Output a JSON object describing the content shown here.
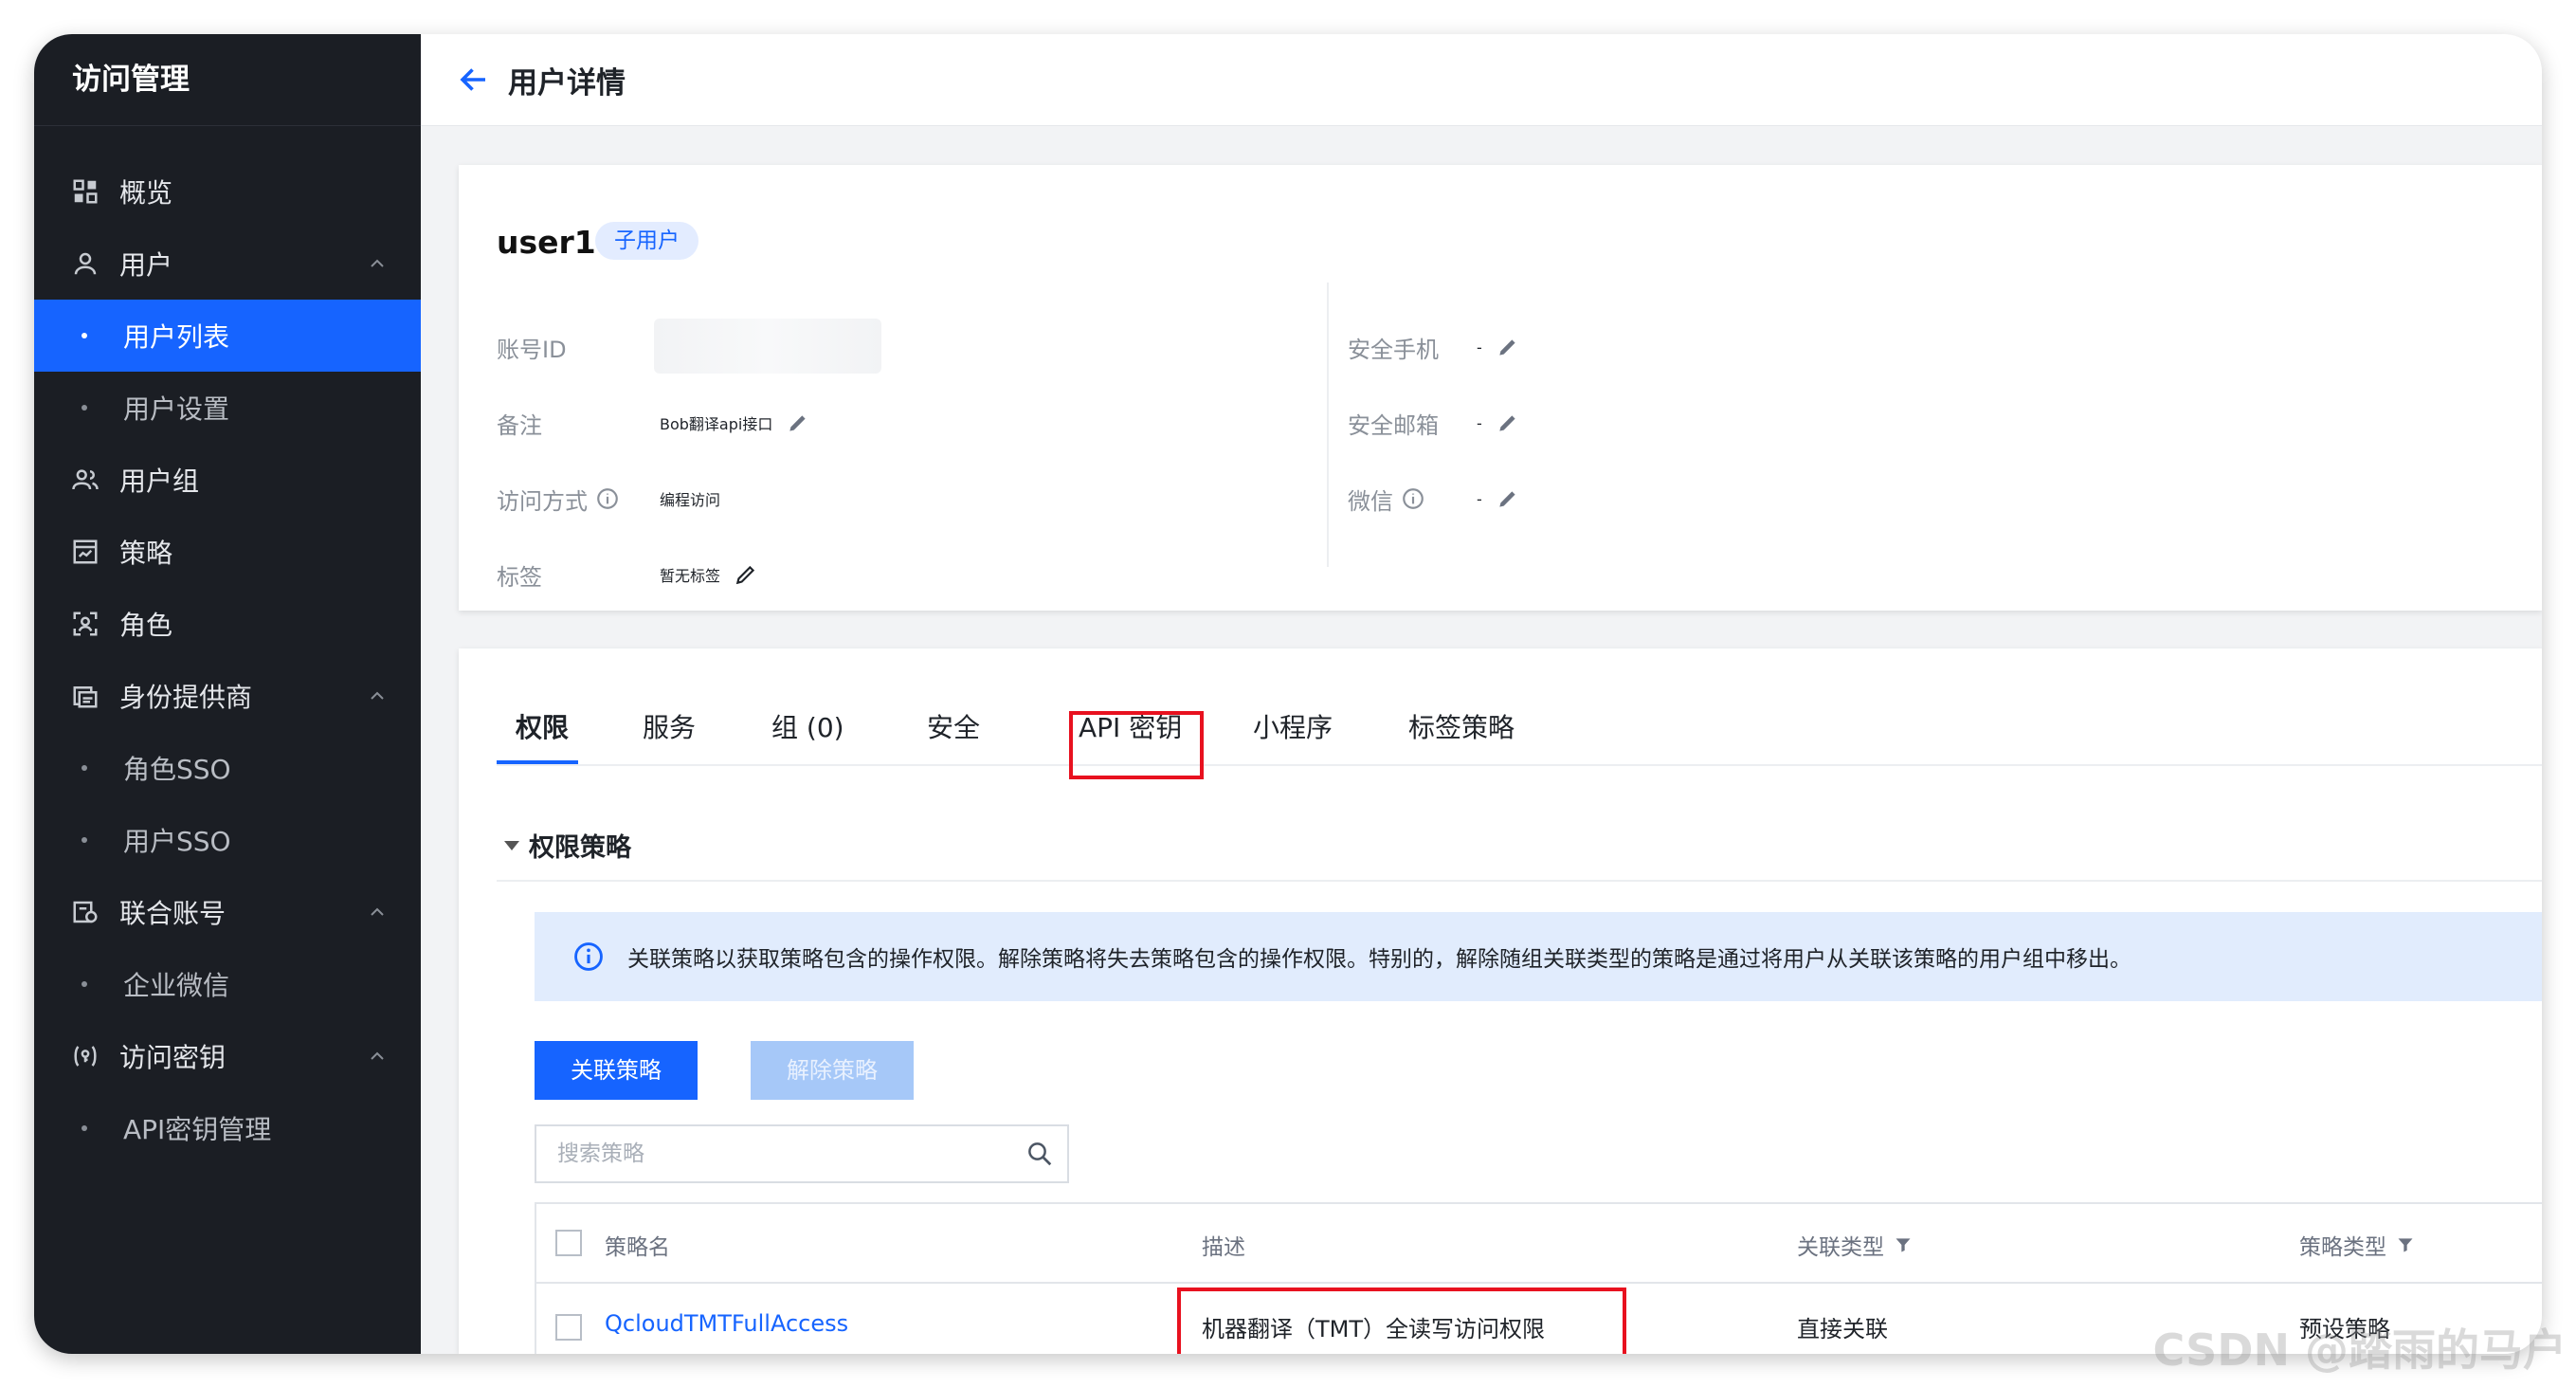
{
  "app": {
    "title": "访问管理"
  },
  "sidebar": {
    "overview": "概览",
    "user": "用户",
    "user_list": "用户列表",
    "user_settings": "用户设置",
    "user_group": "用户组",
    "policy": "策略",
    "role": "角色",
    "idp": "身份提供商",
    "role_sso": "角色SSO",
    "user_sso": "用户SSO",
    "federated": "联合账号",
    "wecom": "企业微信",
    "access_key": "访问密钥",
    "api_key_mgmt": "API密钥管理"
  },
  "header": {
    "title": "用户详情"
  },
  "user": {
    "name": "user1",
    "badge": "子用户",
    "account_id_label": "账号ID",
    "remark_label": "备注",
    "remark_value": "Bob翻译api接口",
    "access_label": "访问方式",
    "access_value": "编程访问",
    "tag_label": "标签",
    "tag_value": "暂无标签",
    "phone_label": "安全手机",
    "phone_value": "-",
    "email_label": "安全邮箱",
    "email_value": "-",
    "wechat_label": "微信",
    "wechat_value": "-"
  },
  "tabs": {
    "permission": "权限",
    "service": "服务",
    "group": "组 (0)",
    "security": "安全",
    "api_key": "API 密钥",
    "mini_program": "小程序",
    "tag_policy": "标签策略"
  },
  "permission": {
    "section_title": "权限策略",
    "notice": "关联策略以获取策略包含的操作权限。解除策略将失去策略包含的操作权限。特别的，解除随组关联类型的策略是通过将用户从关联该策略的用户组中移出。",
    "attach_button": "关联策略",
    "detach_button": "解除策略",
    "search_placeholder": "搜索策略",
    "columns": {
      "name": "策略名",
      "desc": "描述",
      "assoc_type": "关联类型",
      "policy_type": "策略类型"
    },
    "rows": [
      {
        "name": "QcloudTMTFullAccess",
        "desc": "机器翻译（TMT）全读写访问权限",
        "assoc_type": "直接关联",
        "policy_type": "预设策略"
      }
    ]
  },
  "watermark": "CSDN @踏雨的马户",
  "colors": {
    "accent": "#1664ff",
    "highlight": "#e8111f",
    "sidebar_bg": "#1b1e24"
  }
}
